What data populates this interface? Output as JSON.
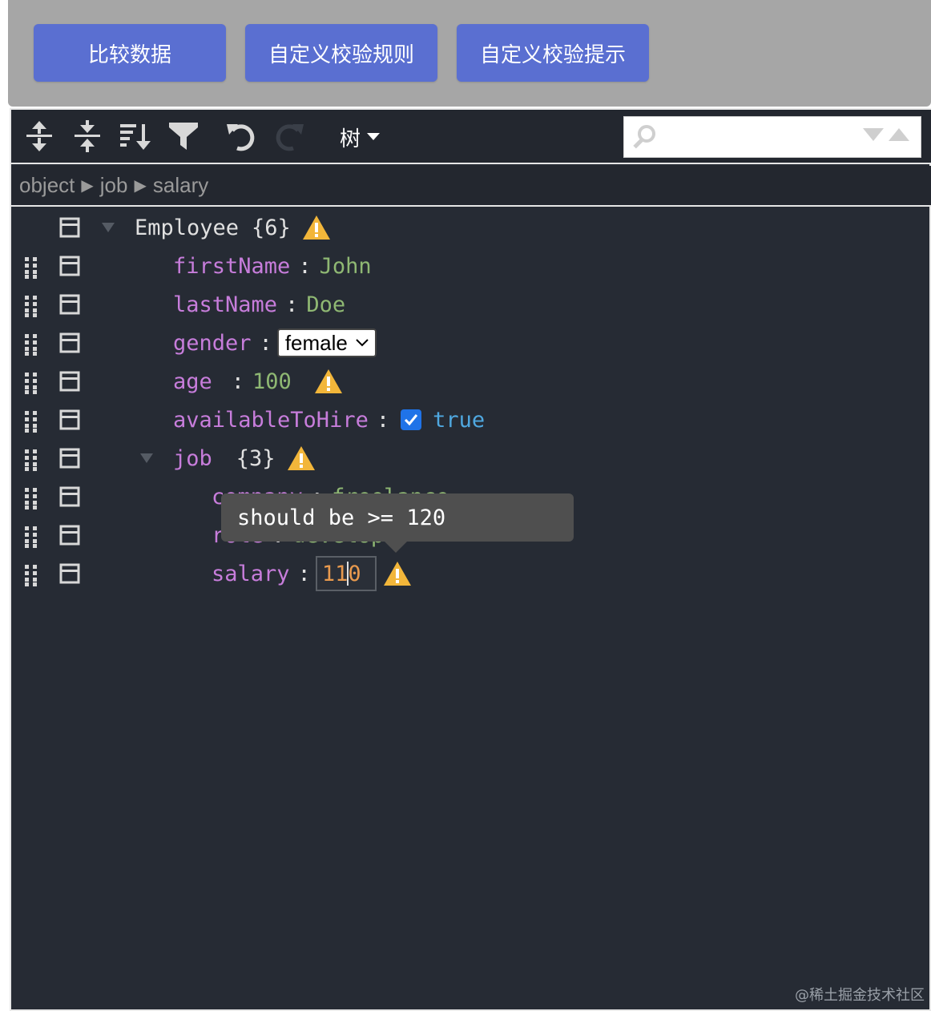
{
  "buttons": {
    "compare": "比较数据",
    "custom_rule": "自定义校验规则",
    "custom_hint": "自定义校验提示"
  },
  "toolbar": {
    "icons": [
      "expand-all-icon",
      "collapse-all-icon",
      "sort-icon",
      "filter-icon",
      "undo-icon",
      "redo-icon"
    ],
    "mode_label": "树",
    "search": {
      "value": "",
      "placeholder": ""
    }
  },
  "breadcrumb": {
    "items": [
      "object",
      "job",
      "salary"
    ],
    "separator": "▶"
  },
  "tree": {
    "root": {
      "key": "Employee",
      "count": "{6}"
    },
    "firstName": {
      "key": "firstName",
      "value": "John"
    },
    "lastName": {
      "key": "lastName",
      "value": "Doe"
    },
    "gender": {
      "key": "gender",
      "value": "female"
    },
    "age": {
      "key": "age",
      "value": "100"
    },
    "availableToHire": {
      "key": "availableToHire",
      "value": "true",
      "checked": true
    },
    "job": {
      "key": "job",
      "count": "{3}"
    },
    "company": {
      "key": "company",
      "value": "freelance"
    },
    "role": {
      "key": "role",
      "value": "develop"
    },
    "salary": {
      "key": "salary",
      "value_before_caret": "11",
      "value_after_caret": "0"
    }
  },
  "tooltip": {
    "text": "should be >= 120"
  },
  "watermark": "@稀土掘金技术社区",
  "colors": {
    "button_bg": "#5a6fd1",
    "editor_bg": "#262b34",
    "key": "#c77ddb",
    "string": "#8fb873",
    "boolean": "#4fa8e0",
    "warning": "#f2b63a",
    "editing_value": "#e99a4e"
  }
}
